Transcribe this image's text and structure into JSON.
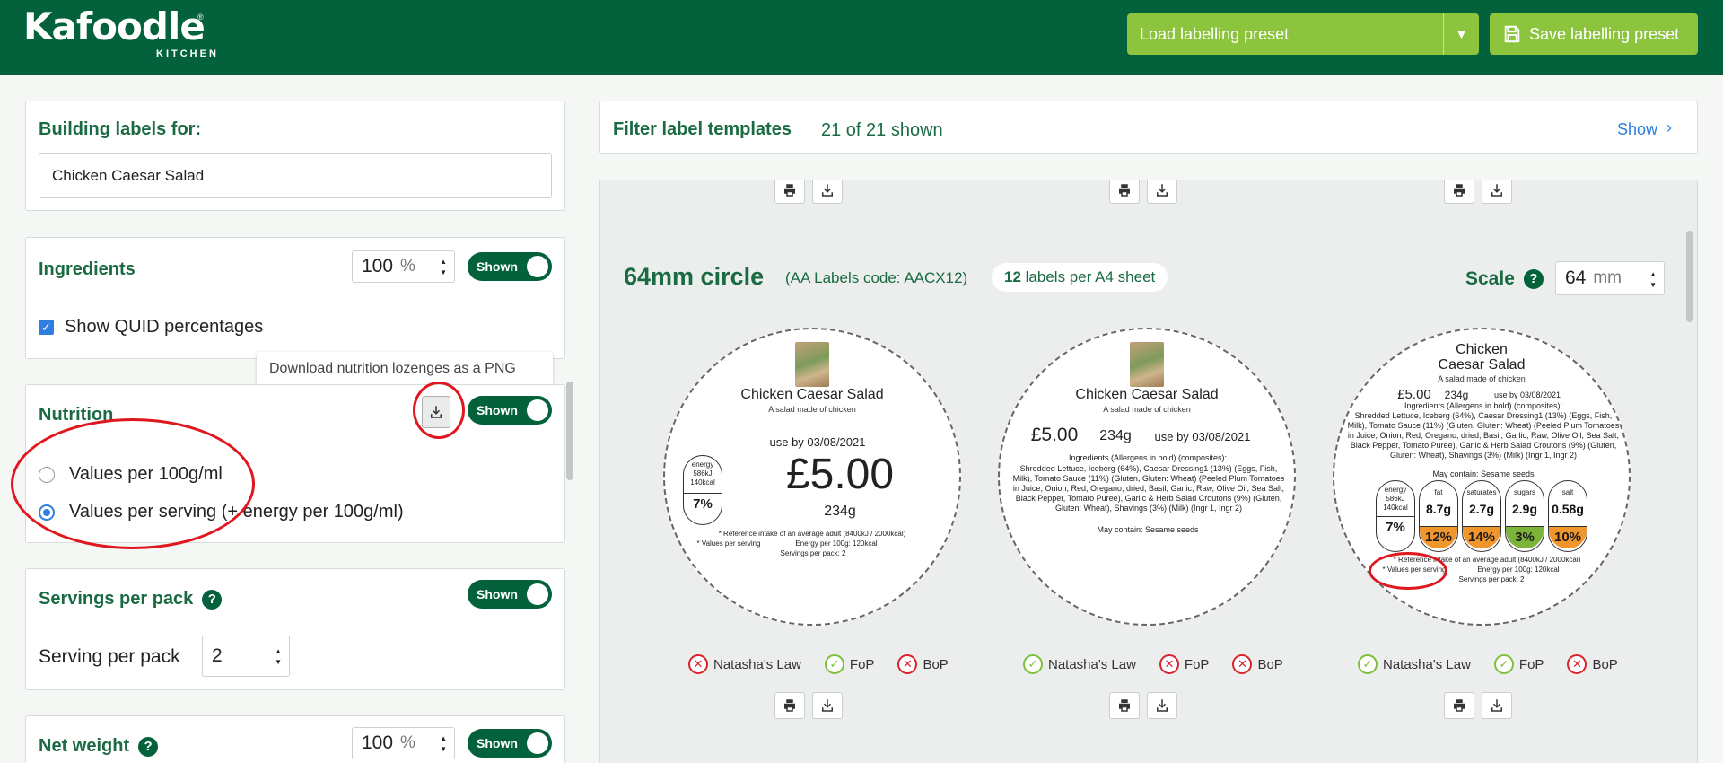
{
  "header": {
    "logo_word": "Kafoodle",
    "logo_sub": "KITCHEN",
    "logo_reg": "®",
    "load_preset": "Load labelling preset",
    "save_preset": "Save labelling preset",
    "brand_color": "#03623c",
    "accent_color": "#8cc43d"
  },
  "building": {
    "title": "Building labels for:",
    "value": "Chicken Caesar Salad"
  },
  "ingredients": {
    "title": "Ingredients",
    "percent": "100",
    "unit": "%",
    "toggle": "Shown",
    "quid_label": "Show QUID percentages"
  },
  "tooltip": "Download nutrition lozenges as a PNG",
  "nutrition": {
    "title": "Nutrition",
    "toggle": "Shown",
    "option_100g": "Values per 100g/ml",
    "option_serving": "Values per serving (+ energy per 100g/ml)"
  },
  "servings": {
    "title": "Servings per pack",
    "help": "?",
    "toggle": "Shown",
    "label": "Serving per pack",
    "value": "2"
  },
  "netweight": {
    "title": "Net weight",
    "help": "?",
    "percent": "100",
    "unit": "%",
    "toggle": "Shown"
  },
  "filter": {
    "title": "Filter label templates",
    "count": "21 of 21 shown",
    "show": "Show",
    "chevron": "›"
  },
  "section": {
    "title": "64mm circle",
    "code": "(AA Labels code: AACX12)",
    "labels_count": "12",
    "labels_text": "labels per A4 sheet",
    "scale_label": "Scale",
    "scale_help": "?",
    "scale_value": "64",
    "scale_unit": "mm"
  },
  "label1": {
    "name": "Chicken Caesar Salad",
    "sub": "A salad made of chicken",
    "useby": "use by 03/08/2021",
    "price": "£5.00",
    "weight": "234g",
    "energy_top": "energy",
    "energy_kj": "586kJ",
    "energy_kcal": "140kcal",
    "energy_pct": "7%",
    "ri_note": "* Reference intake of an average adult (8400kJ / 2000kcal)",
    "values_per_serving": "* Values per serving",
    "energy_per_100g": "Energy per 100g: 120kcal",
    "servings_per_pack": "Servings per pack: 2"
  },
  "label2": {
    "name": "Chicken Caesar Salad",
    "sub": "A salad made of chicken",
    "price": "£5.00",
    "weight": "234g",
    "useby": "use by 03/08/2021",
    "ingredients_head": "Ingredients (Allergens in bold) (composites):",
    "ingredients_text": "Shredded Lettuce, Iceberg (64%), Caesar Dressing1 (13%) (Eggs, Fish, Milk), Tomato Sauce (11%) (Gluten, Gluten: Wheat) (Peeled Plum Tomatoes in Juice, Onion, Red, Oregano, dried, Basil, Garlic, Raw, Olive Oil, Sea Salt, Black Pepper, Tomato Puree), Garlic & Herb Salad Croutons (9%) (Gluten, Gluten: Wheat), Shavings (3%) (Milk) (Ingr 1, Ingr 2)",
    "may_contain": "May contain: Sesame seeds"
  },
  "label3": {
    "name_line1": "Chicken",
    "name_line2": "Caesar Salad",
    "sub": "A salad made of chicken",
    "price": "£5.00",
    "weight": "234g",
    "useby": "use by 03/08/2021",
    "ingredients_head": "Ingredients (Allergens in bold) (composites):",
    "ingredients_text": "Shredded Lettuce, Iceberg (64%), Caesar Dressing1 (13%) (Eggs, Fish, Milk), Tomato Sauce (11%) (Gluten, Gluten: Wheat) (Peeled Plum Tomatoes in Juice, Onion, Red, Oregano, dried, Basil, Garlic, Raw, Olive Oil, Sea Salt, Black Pepper, Tomato Puree), Garlic & Herb Salad Croutons (9%) (Gluten, Gluten: Wheat), Shavings (3%) (Milk) (Ingr 1, Ingr 2)",
    "may_contain": "May contain: Sesame seeds",
    "lozenges": [
      {
        "name": "energy",
        "v1": "586kJ",
        "v2": "140kcal",
        "pct": "7%",
        "color": "#ffffff"
      },
      {
        "name": "fat",
        "v1": "8.7g",
        "v2": "",
        "pct": "12%",
        "color": "#f0962d"
      },
      {
        "name": "saturates",
        "v1": "2.7g",
        "v2": "",
        "pct": "14%",
        "color": "#f0962d"
      },
      {
        "name": "sugars",
        "v1": "2.9g",
        "v2": "",
        "pct": "3%",
        "color": "#7cb43a"
      },
      {
        "name": "salt",
        "v1": "0.58g",
        "v2": "",
        "pct": "10%",
        "color": "#f0962d"
      }
    ],
    "ri_note": "* Reference intake of an average adult (8400kJ / 2000kcal)",
    "values_per_serving": "* Values per serving",
    "energy_per_100g": "Energy per 100g: 120kcal",
    "servings_per_pack": "Servings per pack: 2"
  },
  "status": {
    "natashas_law": "Natasha's Law",
    "fop": "FoP",
    "bop": "BoP",
    "fail_glyph": "✕",
    "pass_glyph": "✓"
  }
}
